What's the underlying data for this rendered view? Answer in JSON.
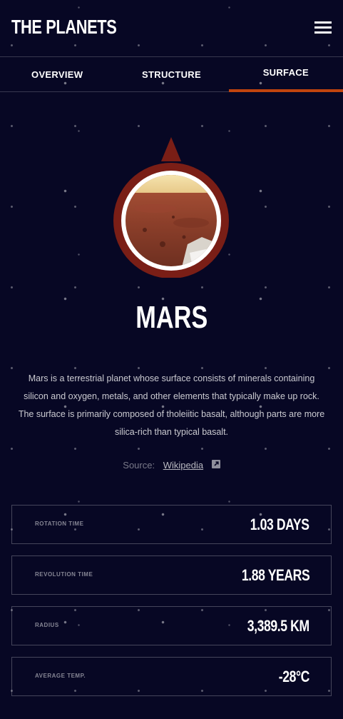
{
  "header": {
    "logo": "THE PLANETS",
    "menu_icon": "hamburger-menu-icon"
  },
  "tabs": [
    {
      "label": "OVERVIEW",
      "active": false
    },
    {
      "label": "STRUCTURE",
      "active": false
    },
    {
      "label": "SURFACE",
      "active": true
    }
  ],
  "planet": {
    "name": "MARS",
    "description": "Mars is a terrestrial planet whose surface consists of minerals containing silicon and oxygen, metals, and other elements that typically make up rock. The surface is primarily composed of tholeiitic basalt, although parts are more silica-rich than typical basalt.",
    "source_label": "Source:",
    "source_link": "Wikipedia",
    "source_icon": "external-link-icon"
  },
  "stats": [
    {
      "label": "ROTATION TIME",
      "value": "1.03 DAYS"
    },
    {
      "label": "REVOLUTION TIME",
      "value": "1.88 YEARS"
    },
    {
      "label": "RADIUS",
      "value": "3,389.5 KM"
    },
    {
      "label": "AVERAGE TEMP.",
      "value": "-28°C"
    }
  ],
  "colors": {
    "background": "#070724",
    "accent": "#C1440E",
    "planet_ring": "#7A1E16"
  }
}
